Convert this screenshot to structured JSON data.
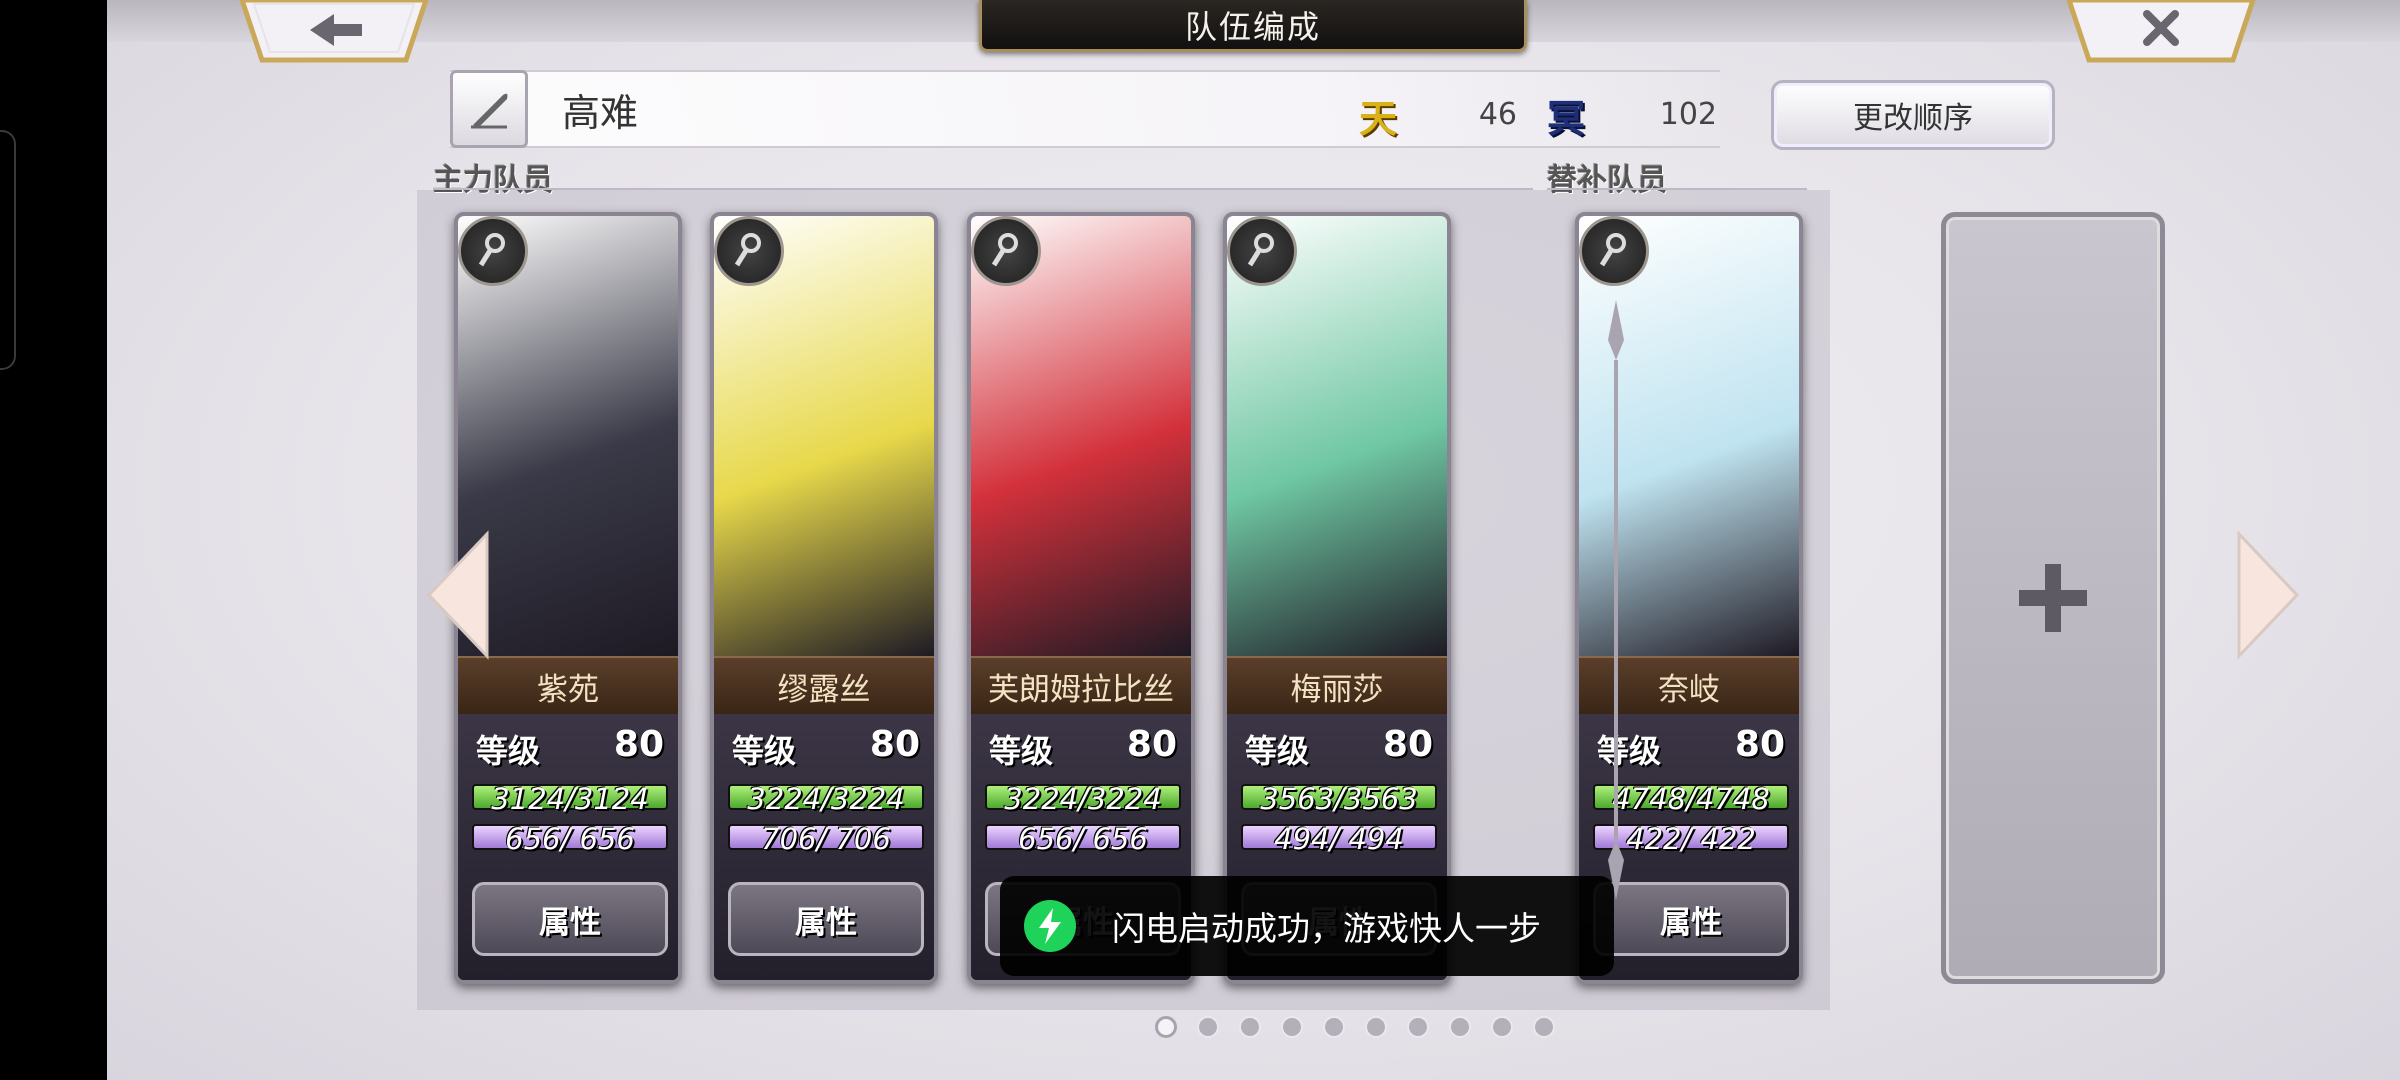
{
  "screen": {
    "title": "队伍编成",
    "back_label": "←",
    "close_label": "✕"
  },
  "party": {
    "name": "高难",
    "heaven_icon_char": "天",
    "heaven_count": "46",
    "hell_icon_char": "冥",
    "hell_count": "102",
    "reorder_label": "更改顺序"
  },
  "sections": {
    "main_label": "主力队员",
    "sub_label": "替补队员"
  },
  "members": [
    {
      "name": "紫苑",
      "level_label": "等级",
      "level": "80",
      "hp": "3124/3124",
      "mp": "656/ 656",
      "button": "属性",
      "role_icon": "key-icon",
      "accent": "#3a3a48"
    },
    {
      "name": "缪露丝",
      "level_label": "等级",
      "level": "80",
      "hp": "3224/3224",
      "mp": "706/ 706",
      "button": "属性",
      "role_icon": "key-icon",
      "accent": "#e7d84a"
    },
    {
      "name": "芙朗姆拉比丝",
      "level_label": "等级",
      "level": "80",
      "hp": "3224/3224",
      "mp": "656/ 656",
      "button": "属性",
      "role_icon": "key-icon",
      "accent": "#d3313b"
    },
    {
      "name": "梅丽莎",
      "level_label": "等级",
      "level": "80",
      "hp": "3563/3563",
      "mp": "494/ 494",
      "button": "属性",
      "role_icon": "sword-icon",
      "accent": "#6fc7a3"
    }
  ],
  "reserves": [
    {
      "name": "奈岐",
      "level_label": "等级",
      "level": "80",
      "hp": "4748/4748",
      "mp": "422/ 422",
      "button": "属性",
      "role_icon": "key-icon",
      "accent": "#bfe3f0"
    }
  ],
  "empty_slot_label": "+",
  "pagination": {
    "total": 10,
    "current": 1
  },
  "toast": {
    "text": "闪电启动成功，游戏快人一步",
    "icon": "lightning-icon"
  }
}
